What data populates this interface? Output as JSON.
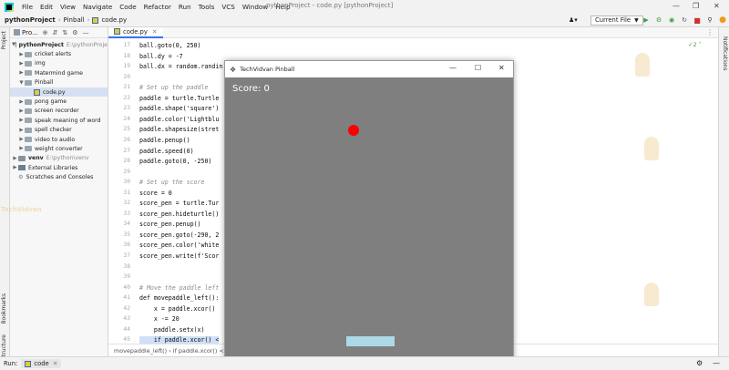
{
  "menu": {
    "items": [
      "File",
      "Edit",
      "View",
      "Navigate",
      "Code",
      "Refactor",
      "Run",
      "Tools",
      "VCS",
      "Window",
      "Help"
    ],
    "window_title": "pythonProject - code.py [pythonProject]"
  },
  "nav": {
    "project": "pythonProject",
    "folder": "Pinball",
    "file": "code.py",
    "run_config": "Current File"
  },
  "project_panel": {
    "title": "Pro...",
    "root": "pythonProject",
    "root_path": "E:\\pythonProje",
    "items": [
      "cricket alerts",
      "img",
      "Matermind game",
      "Pinball",
      "code.py",
      "pong game",
      "screen recorder",
      "speak meaning of word",
      "spell checker",
      "video to audio",
      "weight converter"
    ],
    "venv": "venv",
    "venv_path": "E:\\python\\venv",
    "external": "External Libraries",
    "scratches": "Scratches and Consoles"
  },
  "editor": {
    "tab": "code.py",
    "warnings": "2",
    "breadcrumb": "movepaddle_left()  ›  if paddle.xcor() < -...",
    "lines": [
      {
        "n": "17",
        "t": "ball.goto(0, 250)"
      },
      {
        "n": "18",
        "t": "ball.dy = -7"
      },
      {
        "n": "19",
        "t": "ball.dx = random.randin"
      },
      {
        "n": "20",
        "t": ""
      },
      {
        "n": "21",
        "t": "# Set up the paddle"
      },
      {
        "n": "22",
        "t": "paddle = turtle.Turtle"
      },
      {
        "n": "23",
        "t": "paddle.shape('square')"
      },
      {
        "n": "24",
        "t": "paddle.color('Lightblu"
      },
      {
        "n": "25",
        "t": "paddle.shapesize(stret"
      },
      {
        "n": "26",
        "t": "paddle.penup()"
      },
      {
        "n": "27",
        "t": "paddle.speed(0)"
      },
      {
        "n": "28",
        "t": "paddle.goto(0, -250)"
      },
      {
        "n": "29",
        "t": ""
      },
      {
        "n": "30",
        "t": "# Set up the score"
      },
      {
        "n": "31",
        "t": "score = 0"
      },
      {
        "n": "32",
        "t": "score_pen = turtle.Tur"
      },
      {
        "n": "33",
        "t": "score_pen.hideturtle()"
      },
      {
        "n": "34",
        "t": "score_pen.penup()"
      },
      {
        "n": "35",
        "t": "score_pen.goto(-290, 2"
      },
      {
        "n": "36",
        "t": "score_pen.color('white"
      },
      {
        "n": "37",
        "t": "score_pen.write(f'Scor"
      },
      {
        "n": "38",
        "t": ""
      },
      {
        "n": "39",
        "t": ""
      },
      {
        "n": "40",
        "t": "# Move the paddle left"
      },
      {
        "n": "41",
        "t": "def movepaddle_left():"
      },
      {
        "n": "42",
        "t": "    x = paddle.xcor()"
      },
      {
        "n": "43",
        "t": "    x -= 20"
      },
      {
        "n": "44",
        "t": "    paddle.setx(x)"
      },
      {
        "n": "45",
        "t": "    if paddle.xcor() <"
      }
    ]
  },
  "game_window": {
    "title": "TechVidvan Pinball",
    "score_text": "Score: 0",
    "ball_color": "#ff0000",
    "paddle_color": "#add8e6",
    "bg_color": "#7f7f7f"
  },
  "watermark": "TechVidvan",
  "side_tabs": {
    "project": "Project",
    "bookmarks": "Bookmarks",
    "structure": "Structure",
    "notifications": "Notifications"
  },
  "status": {
    "run_label": "Run:",
    "run_tab": "code"
  }
}
